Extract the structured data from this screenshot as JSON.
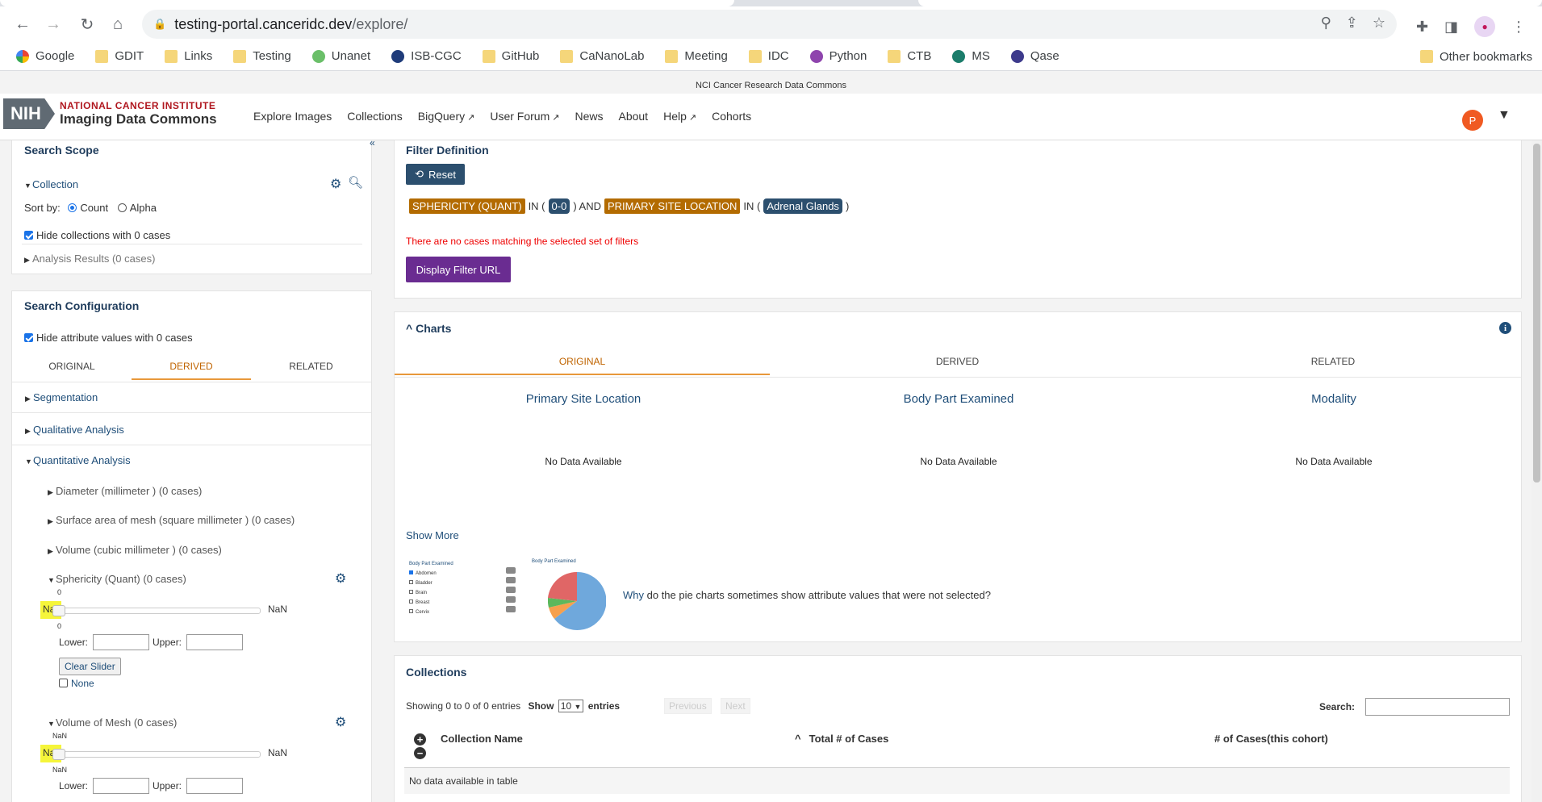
{
  "browser": {
    "url_host": "testing-portal.canceridc.dev",
    "url_path": "/explore/",
    "bookmarks": [
      {
        "label": "Google",
        "kind": "google"
      },
      {
        "label": "GDIT",
        "kind": "folder"
      },
      {
        "label": "Links",
        "kind": "folder"
      },
      {
        "label": "Testing",
        "kind": "folder"
      },
      {
        "label": "Unanet",
        "kind": "site"
      },
      {
        "label": "ISB-CGC",
        "kind": "site"
      },
      {
        "label": "GitHub",
        "kind": "folder"
      },
      {
        "label": "CaNanoLab",
        "kind": "folder"
      },
      {
        "label": "Meeting",
        "kind": "folder"
      },
      {
        "label": "IDC",
        "kind": "folder"
      },
      {
        "label": "Python",
        "kind": "site"
      },
      {
        "label": "CTB",
        "kind": "folder"
      },
      {
        "label": "MS",
        "kind": "site"
      },
      {
        "label": "Qase",
        "kind": "site"
      }
    ],
    "other_bookmarks": "Other bookmarks"
  },
  "site": {
    "banner": "NCI Cancer Research Data Commons",
    "logo_abbr": "NIH",
    "logo_line1": "NATIONAL CANCER INSTITUTE",
    "logo_line2": "Imaging Data Commons",
    "menu": {
      "explore": "Explore Images",
      "collections": "Collections",
      "bigquery": "BigQuery",
      "forum": "User Forum",
      "news": "News",
      "about": "About",
      "help": "Help",
      "cohorts": "Cohorts"
    },
    "user_initial": "P"
  },
  "scope": {
    "title": "Search Scope",
    "collection": "Collection",
    "sort_by": "Sort by:",
    "sort_count": "Count",
    "sort_alpha": "Alpha",
    "hide_collections": "Hide collections with 0 cases",
    "analysis_results": "Analysis Results (0 cases)"
  },
  "config": {
    "title": "Search Configuration",
    "hide_attr": "Hide attribute values with 0 cases",
    "tabs": {
      "original": "ORIGINAL",
      "derived": "DERIVED",
      "related": "RELATED"
    },
    "segmentation": "Segmentation",
    "qualitative": "Qualitative Analysis",
    "quantitative": "Quantitative Analysis",
    "diameter": "Diameter (millimeter ) (0 cases)",
    "surface": "Surface area of mesh (square millimeter ) (0 cases)",
    "volume": "Volume (cubic millimeter ) (0 cases)",
    "sphericity": {
      "label": "Sphericity (Quant) (0 cases)",
      "min_label": "Na",
      "max_label": "NaN",
      "tick_top": "0",
      "tick_bottom": "0",
      "lower": "Lower:",
      "upper": "Upper:",
      "clear": "Clear Slider",
      "none": "None"
    },
    "volume_mesh": {
      "label": "Volume of Mesh (0 cases)",
      "min_label": "Na",
      "max_label": "NaN",
      "tick_top": "NaN",
      "tick_bottom": "NaN",
      "lower": "Lower:",
      "upper": "Upper:"
    }
  },
  "filter": {
    "title": "Filter Definition",
    "reset": "Reset",
    "term1": "SPHERICITY (QUANT)",
    "in1": "IN (",
    "val1": "0-0",
    "and": ") AND",
    "term2": "PRIMARY SITE LOCATION",
    "in2": "IN (",
    "val2": "Adrenal Glands",
    "close": ")",
    "error": "There are no cases matching the selected set of filters",
    "display_url": "Display Filter URL"
  },
  "charts": {
    "title": "Charts",
    "tabs": {
      "original": "ORIGINAL",
      "derived": "DERIVED",
      "related": "RELATED"
    },
    "primary": "Primary Site Location",
    "body_part": "Body Part Examined",
    "modality": "Modality",
    "no_data": "No Data Available",
    "show_more": "Show More",
    "help_why": "Why",
    "help_text": "do the pie charts sometimes show attribute values that were not selected?",
    "mini_legend_title": "Body Part Examined",
    "mini_legend": [
      "Abdomen",
      "Bladder",
      "Brain",
      "Breast",
      "Cervix"
    ],
    "mini_pie_title": "Body Part Examined",
    "pie_colors": [
      "#6fa8dc",
      "#f6a04d",
      "#5cb85c",
      "#e06666"
    ]
  },
  "collections": {
    "title": "Collections",
    "showing": "Showing 0 to 0 of 0 entries",
    "show": "Show",
    "page_size": "10",
    "entries": "entries",
    "previous": "Previous",
    "next": "Next",
    "search": "Search:",
    "col_name": "Collection Name",
    "col_total": "Total # of Cases",
    "col_cohort": "# of Cases(this cohort)",
    "empty": "No data available in table"
  }
}
